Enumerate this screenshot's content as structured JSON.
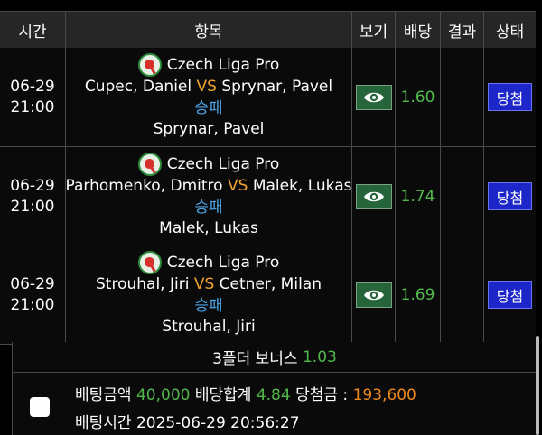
{
  "header": {
    "time": "시간",
    "item": "항목",
    "view": "보기",
    "odds": "배당",
    "result": "결과",
    "status": "상태"
  },
  "bets": [
    {
      "date": "06-29",
      "time": "21:00",
      "league": "Czech Liga Pro",
      "home": "Cupec, Daniel",
      "vs": "VS",
      "away": "Sprynar, Pavel",
      "market": "승패",
      "pick": "Sprynar, Pavel",
      "odds": "1.60",
      "result": "",
      "status": "당첨"
    },
    {
      "date": "06-29",
      "time": "21:00",
      "league": "Czech Liga Pro",
      "home": "Parhomenko, Dmitro",
      "vs": "VS",
      "away": "Malek, Lukas",
      "market": "승패",
      "pick": "Malek, Lukas",
      "odds": "1.74",
      "result": "",
      "status": "당첨"
    },
    {
      "date": "06-29",
      "time": "21:00",
      "league": "Czech Liga Pro",
      "home": "Strouhal, Jiri",
      "vs": "VS",
      "away": "Cetner, Milan",
      "market": "승패",
      "pick": "Strouhal, Jiri",
      "odds": "1.69",
      "result": "",
      "status": "당첨"
    }
  ],
  "bonus": {
    "label": "3폴더 보너스",
    "value": "1.03"
  },
  "summary": {
    "amount_label": "배팅금액",
    "amount": "40,000",
    "total_odds_label": "배당합계",
    "total_odds": "4.84",
    "win_label": "당첨금 :",
    "win_amount": "193,600",
    "time_label": "배팅시간",
    "time_value": "2025-06-29 20:56:27"
  },
  "icons": {
    "league": "table-tennis-icon",
    "view": "eye-icon"
  },
  "colors": {
    "vs": "#f0a330",
    "market": "#4da6e8",
    "odds": "#52b84c",
    "win_amount": "#f08a1d",
    "status_button": "#1d27c9",
    "view_button": "#26653a"
  }
}
